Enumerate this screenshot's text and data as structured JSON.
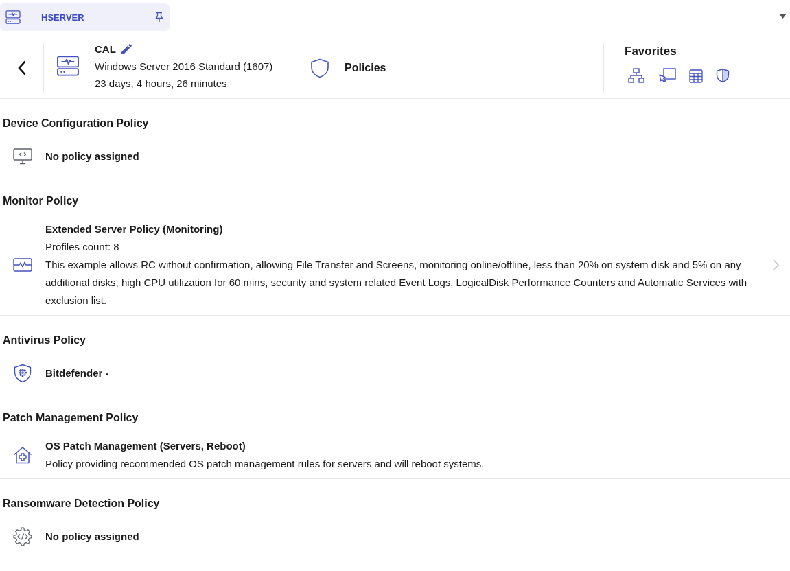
{
  "tab": {
    "title": "HSERVER"
  },
  "device": {
    "name": "CAL",
    "os": "Windows Server 2016 Standard (1607)",
    "uptime": "23 days, 4 hours, 26 minutes"
  },
  "page": {
    "title": "Policies"
  },
  "favorites": {
    "title": "Favorites"
  },
  "policies": [
    {
      "kind": "configuration",
      "heading": "Device Configuration Policy",
      "name": "No policy assigned",
      "navigable": false
    },
    {
      "kind": "monitor",
      "heading": "Monitor Policy",
      "name": "Extended Server Policy (Monitoring)",
      "profiles": "Profiles count: 8",
      "description": "This example allows RC without confirmation, allowing File Transfer and Screens, monitoring online/offline, less than 20% on system disk and 5% on any additional disks, high CPU utilization for 60 mins, security and system related Event Logs, LogicalDisk Performance Counters and Automatic Services with exclusion list.",
      "navigable": true
    },
    {
      "kind": "antivirus",
      "heading": "Antivirus Policy",
      "name": "Bitdefender -",
      "navigable": false
    },
    {
      "kind": "patch",
      "heading": "Patch Management Policy",
      "name": "OS Patch Management (Servers, Reboot)",
      "description": "Policy providing recommended OS patch management rules for servers and will reboot systems.",
      "navigable": false
    },
    {
      "kind": "ransomware",
      "heading": "Ransomware Detection Policy",
      "name": "No policy assigned",
      "navigable": false
    }
  ]
}
